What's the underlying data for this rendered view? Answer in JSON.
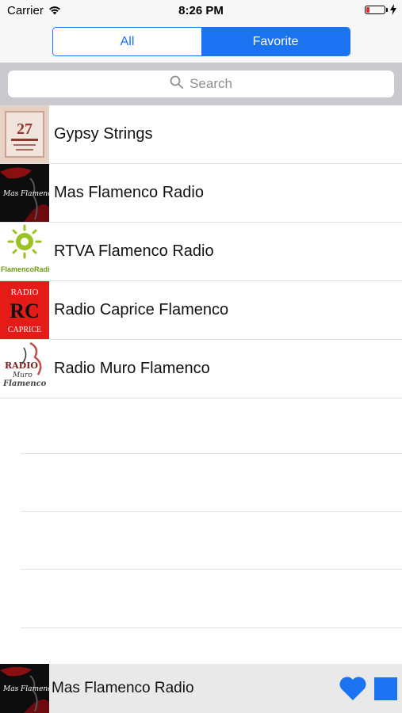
{
  "status_bar": {
    "carrier": "Carrier",
    "time": "8:26 PM",
    "battery_color": "#e0312f"
  },
  "segmented": {
    "all_label": "All",
    "favorite_label": "Favorite",
    "selected": "Favorite",
    "accent": "#1a73f0"
  },
  "search": {
    "placeholder": "Search",
    "icon": "search-icon"
  },
  "stations": [
    {
      "name": "Gypsy Strings",
      "logo_text": "27"
    },
    {
      "name": "Mas Flamenco Radio",
      "logo_text": "Mas Flamenco Radio"
    },
    {
      "name": "RTVA Flamenco Radio",
      "logo_text": "FlamencoRadio"
    },
    {
      "name": "Radio Caprice Flamenco",
      "logo_text": [
        "RADIO",
        "RC",
        "CAPRICE"
      ]
    },
    {
      "name": "Radio Muro Flamenco",
      "logo_text": [
        "RADIO",
        "Muro",
        "Flamenco"
      ]
    }
  ],
  "now_playing": {
    "name": "Mas Flamenco Radio",
    "logo_text": "Mas Flamenco Radio",
    "favorite_icon": "heart-icon",
    "stop_icon": "stop-icon"
  }
}
